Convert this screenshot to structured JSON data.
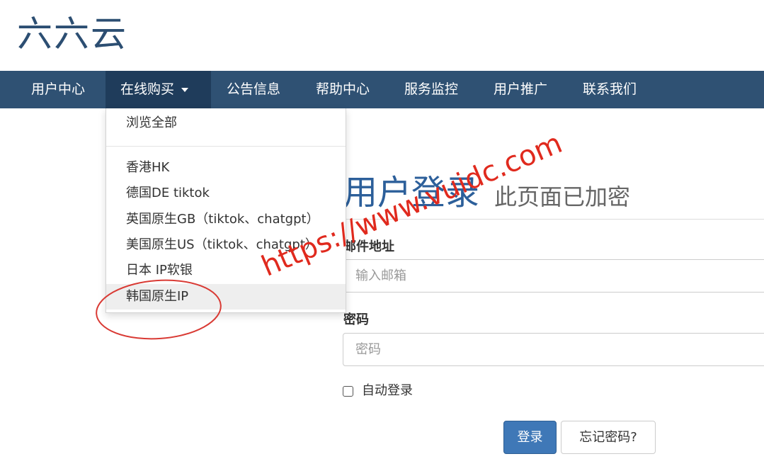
{
  "brand": "六六云",
  "nav": {
    "items": [
      {
        "label": "用户中心"
      },
      {
        "label": "在线购买",
        "active": true,
        "dropdown": true
      },
      {
        "label": "公告信息"
      },
      {
        "label": "帮助中心"
      },
      {
        "label": "服务监控"
      },
      {
        "label": "用户推广"
      },
      {
        "label": "联系我们"
      }
    ]
  },
  "dropdown": {
    "view_all": "浏览全部",
    "items": [
      {
        "label": "香港HK"
      },
      {
        "label": "德国DE tiktok"
      },
      {
        "label": "英国原生GB（tiktok、chatgpt）"
      },
      {
        "label": "美国原生US（tiktok、chatgpt）"
      },
      {
        "label": "日本 IP软银"
      },
      {
        "label": "韩国原生IP",
        "highlighted": true
      }
    ]
  },
  "login": {
    "title": "用户登录",
    "subtitle": "此页面已加密",
    "email_label": "邮件地址",
    "email_placeholder": "输入邮箱",
    "password_label": "密码",
    "password_placeholder": "密码",
    "remember_label": "自动登录",
    "submit_label": "登录",
    "forgot_label": "忘记密码?"
  },
  "watermark": "https://www.vuidc.com",
  "colors": {
    "brand": "#2c4e72",
    "navbar": "#2f5173",
    "nav_active": "#1f3c5b",
    "title": "#2c5f9a",
    "primary_button": "#3f78b7",
    "annotation": "#d93a34",
    "watermark": "#e02a1e"
  }
}
